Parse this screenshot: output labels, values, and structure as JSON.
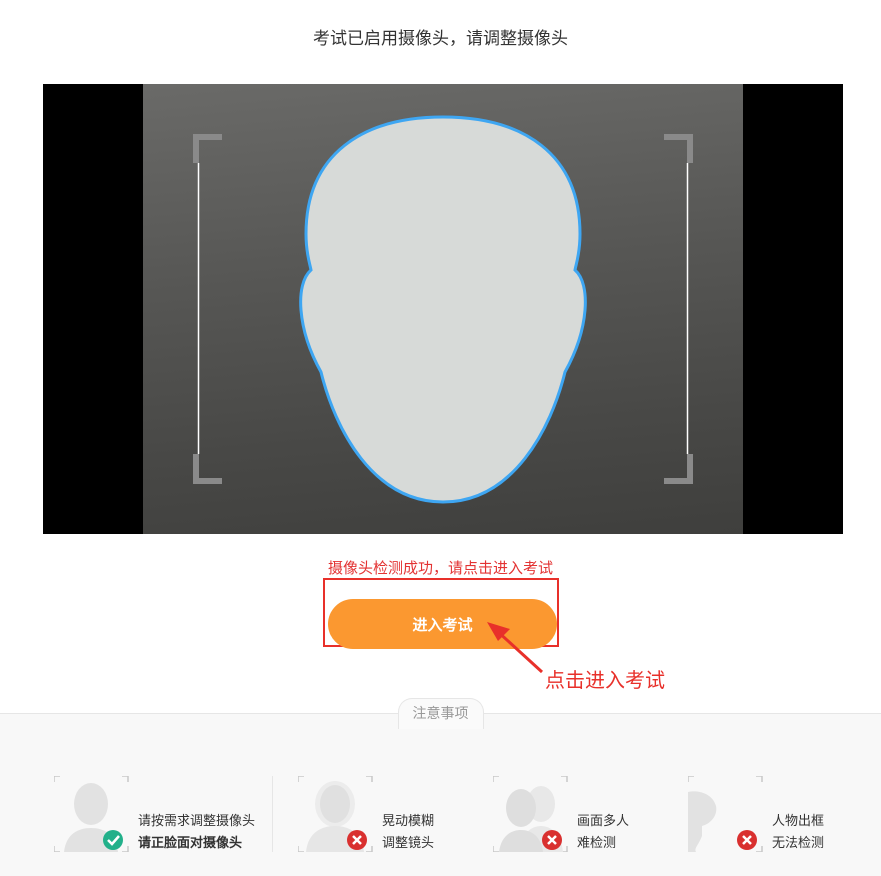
{
  "header": {
    "title": "考试已启用摄像头，请调整摄像头"
  },
  "camera": {
    "status_text": "摄像头检测成功，请点击进入考试"
  },
  "actions": {
    "enter_label": "进入考试"
  },
  "annotation": {
    "text": "点击进入考试"
  },
  "notes": {
    "title": "注意事项",
    "items": [
      {
        "line1": "请按需求调整摄像头",
        "line2": "请正脸面对摄像头",
        "status": "ok",
        "icon": "single-person-icon"
      },
      {
        "line1": "晃动模糊",
        "line2": "调整镜头",
        "status": "error",
        "icon": "blurry-person-icon"
      },
      {
        "line1": "画面多人",
        "line2": "难检测",
        "status": "error",
        "icon": "multiple-people-icon"
      },
      {
        "line1": "人物出框",
        "line2": "无法检测",
        "status": "error",
        "icon": "out-of-frame-person-icon"
      }
    ]
  },
  "colors": {
    "accent": "#fb9830",
    "error": "#e8302a",
    "ok": "#22b08a",
    "face_outline": "#3ea6f2"
  }
}
